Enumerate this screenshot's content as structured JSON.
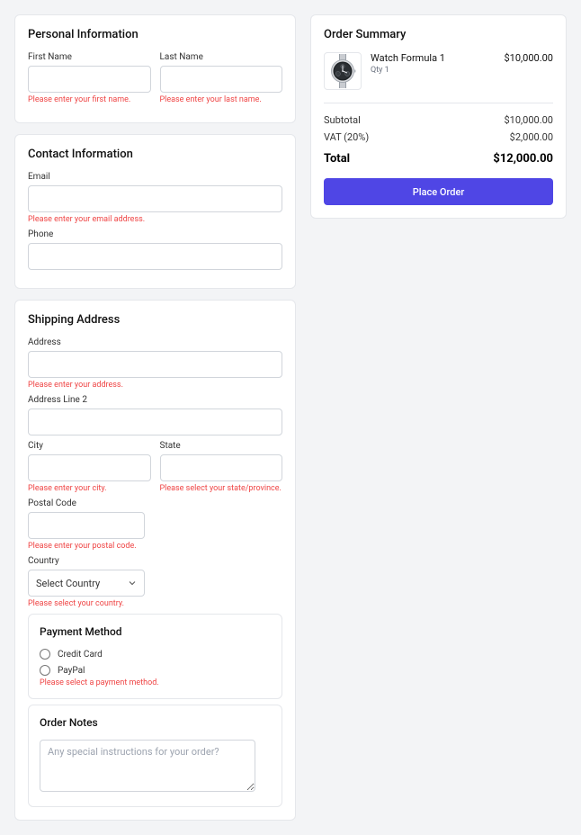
{
  "personal": {
    "title": "Personal Information",
    "firstName": {
      "label": "First Name",
      "value": "",
      "error": "Please enter your first name."
    },
    "lastName": {
      "label": "Last Name",
      "value": "",
      "error": "Please enter your last name."
    }
  },
  "contact": {
    "title": "Contact Information",
    "email": {
      "label": "Email",
      "value": "",
      "error": "Please enter your email address."
    },
    "phone": {
      "label": "Phone",
      "value": ""
    }
  },
  "shipping": {
    "title": "Shipping Address",
    "address": {
      "label": "Address",
      "value": "",
      "error": "Please enter your address."
    },
    "address2": {
      "label": "Address Line 2",
      "value": ""
    },
    "city": {
      "label": "City",
      "value": "",
      "error": "Please enter your city."
    },
    "state": {
      "label": "State",
      "value": "",
      "error": "Please select your state/province."
    },
    "postal": {
      "label": "Postal Code",
      "value": "",
      "error": "Please enter your postal code."
    },
    "country": {
      "label": "Country",
      "selected": "Select Country",
      "error": "Please select your country."
    }
  },
  "payment": {
    "title": "Payment Method",
    "options": {
      "credit": "Credit Card",
      "paypal": "PayPal"
    },
    "error": "Please select a payment method."
  },
  "notes": {
    "title": "Order Notes",
    "placeholder": "Any special instructions for your order?",
    "value": ""
  },
  "summary": {
    "title": "Order Summary",
    "item": {
      "name": "Watch Formula 1",
      "qty": "Qty 1",
      "price": "$10,000.00"
    },
    "subtotal": {
      "label": "Subtotal",
      "value": "$10,000.00"
    },
    "vat": {
      "label": "VAT (20%)",
      "value": "$2,000.00"
    },
    "total": {
      "label": "Total",
      "value": "$12,000.00"
    },
    "placeOrder": "Place Order"
  }
}
